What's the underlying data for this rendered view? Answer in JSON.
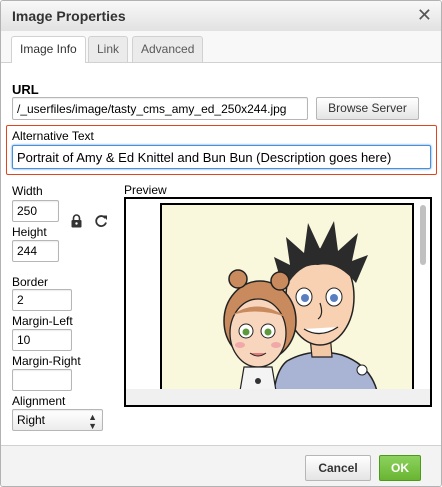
{
  "dialog": {
    "title": "Image Properties",
    "close_label": "✕"
  },
  "tabs": [
    {
      "label": "Image Info",
      "active": true
    },
    {
      "label": "Link",
      "active": false
    },
    {
      "label": "Advanced",
      "active": false
    }
  ],
  "url": {
    "label": "URL",
    "value": "/_userfiles/image/tasty_cms_amy_ed_250x244.jpg",
    "browse_label": "Browse Server"
  },
  "alt_text": {
    "label": "Alternative Text",
    "value": "Portrait of Amy & Ed Knittel and Bun Bun (Description goes here)"
  },
  "dimensions": {
    "width_label": "Width",
    "width_value": "250",
    "height_label": "Height",
    "height_value": "244",
    "lock_icon": "lock-icon",
    "reset_icon": "reset-size-icon"
  },
  "border": {
    "label": "Border",
    "value": "2"
  },
  "margin_left": {
    "label": "Margin-Left",
    "value": "10"
  },
  "margin_right": {
    "label": "Margin-Right",
    "value": ""
  },
  "alignment": {
    "label": "Alignment",
    "value": "Right"
  },
  "preview": {
    "label": "Preview"
  },
  "footer": {
    "cancel_label": "Cancel",
    "ok_label": "OK"
  },
  "colors": {
    "ok_green": "#69b532",
    "focus_red": "#e0461e",
    "focus_blue": "#4a90d9"
  }
}
